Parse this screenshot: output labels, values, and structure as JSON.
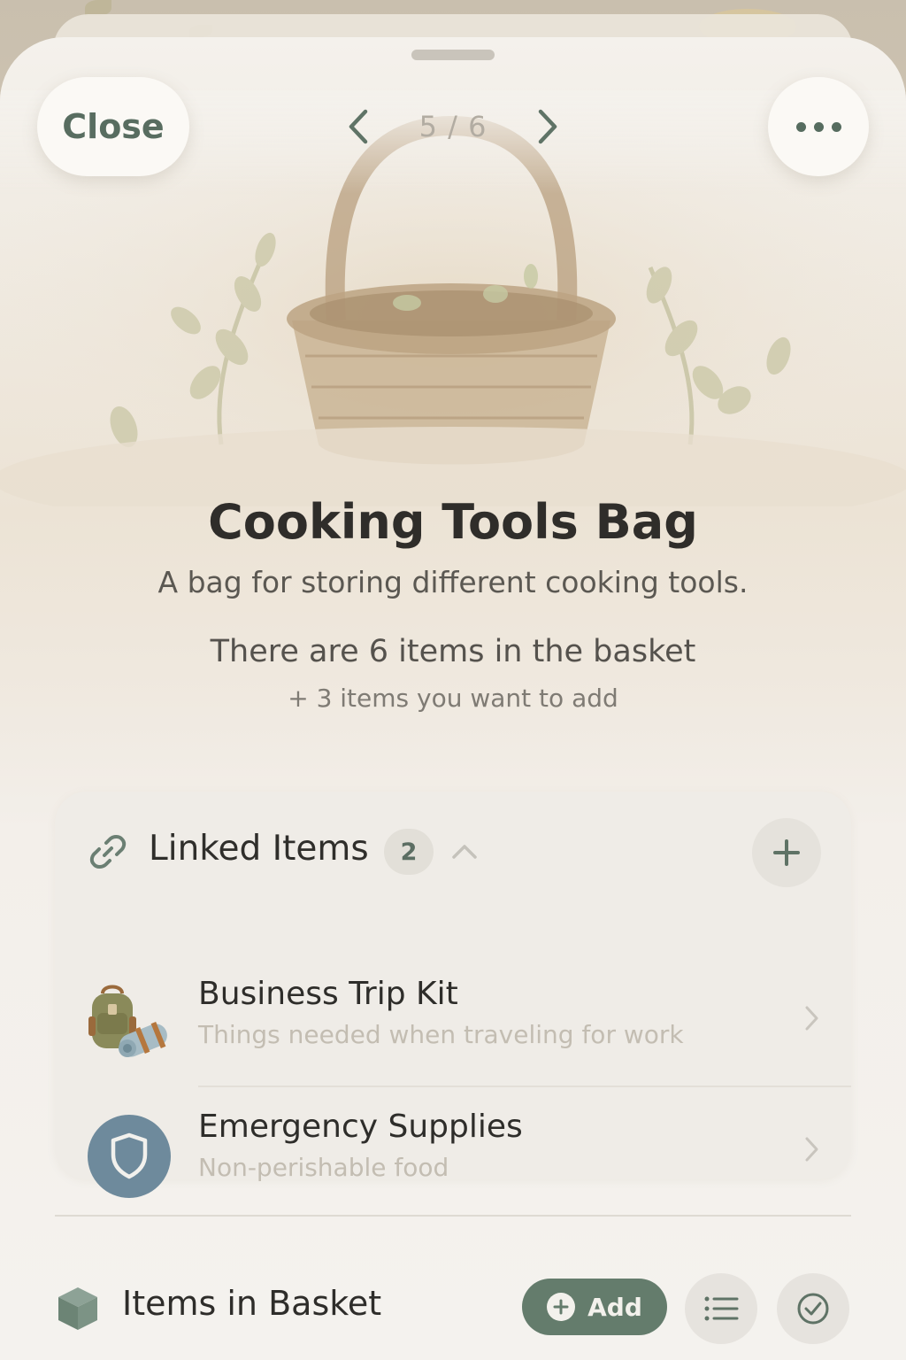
{
  "header": {
    "close_label": "Close",
    "pager_text": "5 / 6",
    "more_icon": "more-horizontal-icon"
  },
  "basket": {
    "title": "Cooking Tools Bag",
    "description": "A bag for storing different cooking tools.",
    "count_text": "There are 6 items in the basket",
    "wish_text": "+ 3 items you want to add"
  },
  "linked": {
    "title": "Linked Items",
    "count": "2",
    "items": [
      {
        "name": "Business Trip Kit",
        "description": "Things needed when traveling for work",
        "icon": "backpack-icon"
      },
      {
        "name": "Emergency Supplies",
        "description": "Non-perishable food",
        "icon": "shield-icon"
      }
    ]
  },
  "items_section": {
    "title": "Items in Basket",
    "add_label": "Add"
  },
  "colors": {
    "accent": "#647c6c",
    "shield_bg": "#6e8a9c",
    "text_primary": "#2f2d2a"
  }
}
